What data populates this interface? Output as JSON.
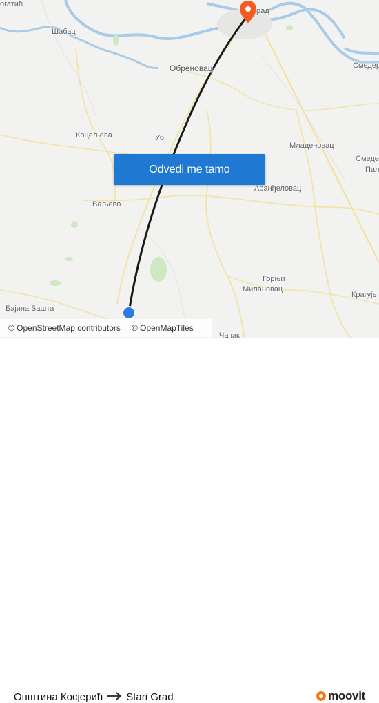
{
  "map": {
    "places": [
      {
        "label": "Шабац"
      },
      {
        "label": "Обреновац"
      },
      {
        "label": "Коцељева"
      },
      {
        "label": "Уб"
      },
      {
        "label": "Ваљево"
      },
      {
        "label": "Младеновац"
      },
      {
        "label": "Смедер"
      },
      {
        "label": "Смеде"
      },
      {
        "label": "Пал"
      },
      {
        "label": "Аранђеловац"
      },
      {
        "label": "Горњи"
      },
      {
        "label": "Милановац"
      },
      {
        "label": "Крагује"
      },
      {
        "label": "Бајина Башта"
      },
      {
        "label": "огатић"
      },
      {
        "label": "рад"
      },
      {
        "label": "Чачак"
      }
    ],
    "route_color": "#1a1a1a",
    "origin_color": "#2d7be5",
    "destination_color": "#f25b23"
  },
  "cta": {
    "label": "Odvedi me tamo"
  },
  "attribution": {
    "osm": "© OpenStreetMap contributors",
    "omt": "© OpenMapTiles"
  },
  "route": {
    "from": "Општина Косјерић",
    "to": "Stari Grad"
  },
  "brand": {
    "name": "moovit"
  }
}
